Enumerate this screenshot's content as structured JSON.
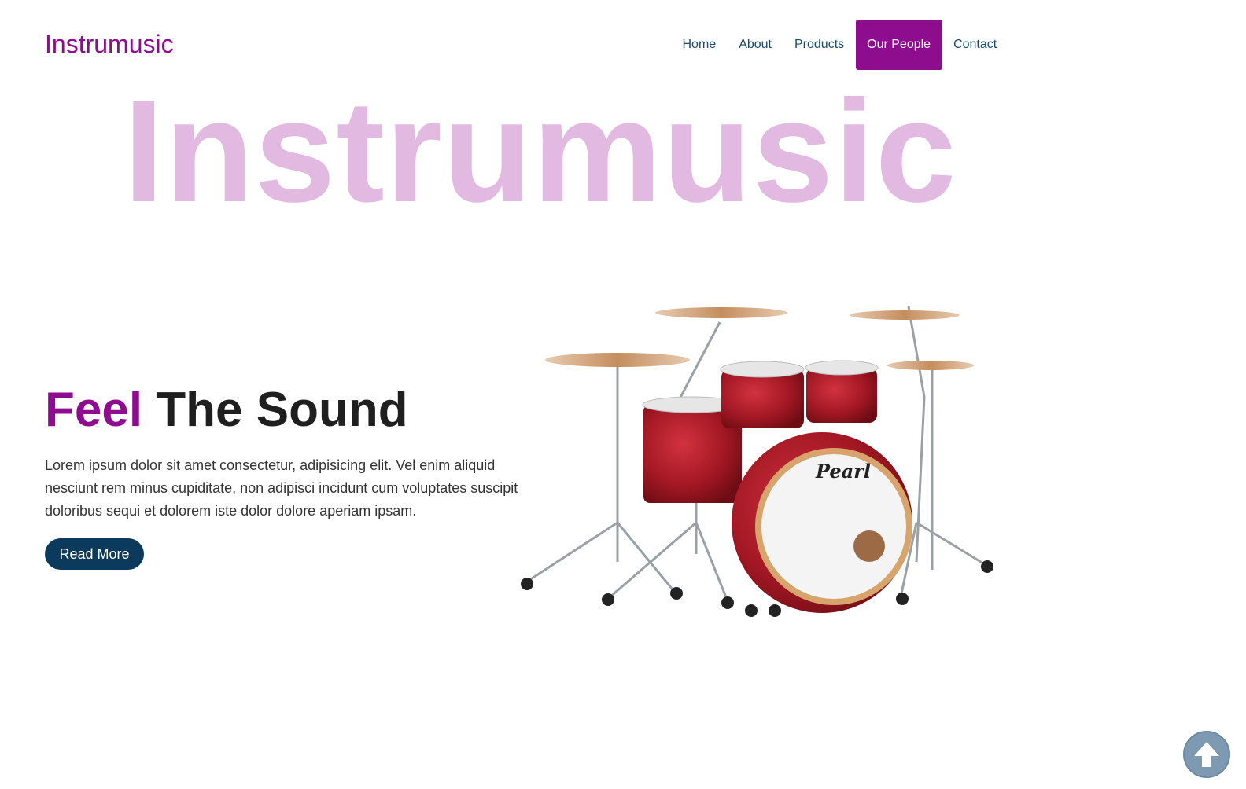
{
  "brand": {
    "logo_text": "Instrumusic",
    "accent_color": "#8e0c8e",
    "nav_color": "#174a6e",
    "button_color": "#0c3a5c"
  },
  "nav": {
    "items": [
      {
        "label": "Home",
        "active": false
      },
      {
        "label": "About",
        "active": false
      },
      {
        "label": "Products",
        "active": false
      },
      {
        "label": "Our People",
        "active": true
      },
      {
        "label": "Contact",
        "active": false
      }
    ]
  },
  "hero": {
    "big_word": "Instrumusic",
    "big_word_color": "#e2b9e0",
    "headline_accent": "Feel",
    "headline_rest": " The Sound",
    "lead": "Lorem ipsum dolor sit amet consectetur, adipisicing elit. Vel enim aliquid nesciunt rem minus cupiditate, non adipisci incidunt cum voluptates suscipit doloribus sequi et dolorem iste dolor dolore aperiam ipsam.",
    "button_label": "Read More",
    "image_icon": "drum-kit",
    "drum_brand": "Pearl"
  },
  "back_to_top": {
    "icon": "arrow-up-icon"
  }
}
